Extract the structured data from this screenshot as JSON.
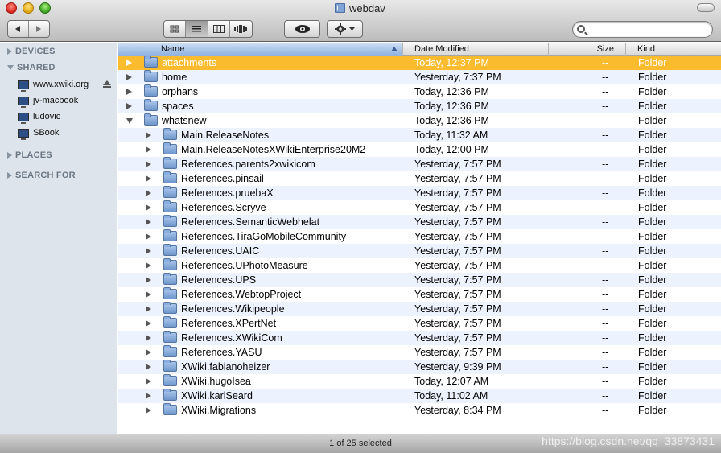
{
  "window": {
    "title": "webdav"
  },
  "search": {
    "value": "",
    "placeholder": ""
  },
  "sidebar": {
    "sections": {
      "devices": "DEVICES",
      "shared": "SHARED",
      "places": "PLACES",
      "search_for": "SEARCH FOR"
    },
    "shared_items": [
      {
        "label": "www.xwiki.org",
        "icon": "monitor-icon"
      },
      {
        "label": "jv-macbook",
        "icon": "monitor-icon"
      },
      {
        "label": "ludovic",
        "icon": "monitor-icon"
      },
      {
        "label": "SBook",
        "icon": "monitor-icon"
      }
    ]
  },
  "columns": {
    "name": "Name",
    "date": "Date Modified",
    "size": "Size",
    "kind": "Kind"
  },
  "rows": [
    {
      "name": "attachments",
      "date": "Today, 12:37 PM",
      "size": "--",
      "kind": "Folder",
      "level": 0,
      "expanded": false,
      "selected": true
    },
    {
      "name": "home",
      "date": "Yesterday, 7:37 PM",
      "size": "--",
      "kind": "Folder",
      "level": 0,
      "expanded": false
    },
    {
      "name": "orphans",
      "date": "Today, 12:36 PM",
      "size": "--",
      "kind": "Folder",
      "level": 0,
      "expanded": false
    },
    {
      "name": "spaces",
      "date": "Today, 12:36 PM",
      "size": "--",
      "kind": "Folder",
      "level": 0,
      "expanded": false
    },
    {
      "name": "whatsnew",
      "date": "Today, 12:36 PM",
      "size": "--",
      "kind": "Folder",
      "level": 0,
      "expanded": true
    },
    {
      "name": "Main.ReleaseNotes",
      "date": "Today, 11:32 AM",
      "size": "--",
      "kind": "Folder",
      "level": 1,
      "expanded": false
    },
    {
      "name": "Main.ReleaseNotesXWikiEnterprise20M2",
      "date": "Today, 12:00 PM",
      "size": "--",
      "kind": "Folder",
      "level": 1,
      "expanded": false
    },
    {
      "name": "References.parents2xwikicom",
      "date": "Yesterday, 7:57 PM",
      "size": "--",
      "kind": "Folder",
      "level": 1,
      "expanded": false
    },
    {
      "name": "References.pinsail",
      "date": "Yesterday, 7:57 PM",
      "size": "--",
      "kind": "Folder",
      "level": 1,
      "expanded": false
    },
    {
      "name": "References.pruebaX",
      "date": "Yesterday, 7:57 PM",
      "size": "--",
      "kind": "Folder",
      "level": 1,
      "expanded": false
    },
    {
      "name": "References.Scryve",
      "date": "Yesterday, 7:57 PM",
      "size": "--",
      "kind": "Folder",
      "level": 1,
      "expanded": false
    },
    {
      "name": "References.SemanticWebhelat",
      "date": "Yesterday, 7:57 PM",
      "size": "--",
      "kind": "Folder",
      "level": 1,
      "expanded": false
    },
    {
      "name": "References.TiraGoMobileCommunity",
      "date": "Yesterday, 7:57 PM",
      "size": "--",
      "kind": "Folder",
      "level": 1,
      "expanded": false
    },
    {
      "name": "References.UAIC",
      "date": "Yesterday, 7:57 PM",
      "size": "--",
      "kind": "Folder",
      "level": 1,
      "expanded": false
    },
    {
      "name": "References.UPhotoMeasure",
      "date": "Yesterday, 7:57 PM",
      "size": "--",
      "kind": "Folder",
      "level": 1,
      "expanded": false
    },
    {
      "name": "References.UPS",
      "date": "Yesterday, 7:57 PM",
      "size": "--",
      "kind": "Folder",
      "level": 1,
      "expanded": false
    },
    {
      "name": "References.WebtopProject",
      "date": "Yesterday, 7:57 PM",
      "size": "--",
      "kind": "Folder",
      "level": 1,
      "expanded": false
    },
    {
      "name": "References.Wikipeople",
      "date": "Yesterday, 7:57 PM",
      "size": "--",
      "kind": "Folder",
      "level": 1,
      "expanded": false
    },
    {
      "name": "References.XPertNet",
      "date": "Yesterday, 7:57 PM",
      "size": "--",
      "kind": "Folder",
      "level": 1,
      "expanded": false
    },
    {
      "name": "References.XWikiCom",
      "date": "Yesterday, 7:57 PM",
      "size": "--",
      "kind": "Folder",
      "level": 1,
      "expanded": false
    },
    {
      "name": "References.YASU",
      "date": "Yesterday, 7:57 PM",
      "size": "--",
      "kind": "Folder",
      "level": 1,
      "expanded": false
    },
    {
      "name": "XWiki.fabianoheizer",
      "date": "Yesterday, 9:39 PM",
      "size": "--",
      "kind": "Folder",
      "level": 1,
      "expanded": false
    },
    {
      "name": "XWiki.hugoIsea",
      "date": "Today, 12:07 AM",
      "size": "--",
      "kind": "Folder",
      "level": 1,
      "expanded": false
    },
    {
      "name": "XWiki.karlSeard",
      "date": "Today, 11:02 AM",
      "size": "--",
      "kind": "Folder",
      "level": 1,
      "expanded": false
    },
    {
      "name": "XWiki.Migrations",
      "date": "Yesterday, 8:34 PM",
      "size": "--",
      "kind": "Folder",
      "level": 1,
      "expanded": false
    }
  ],
  "status": {
    "text": "1 of 25 selected",
    "watermark": "https://blog.csdn.net/qq_33873431"
  },
  "colors": {
    "selection": "#fbbb2f",
    "stripe": "#edf3fe",
    "sidebar": "#dde4eb"
  }
}
